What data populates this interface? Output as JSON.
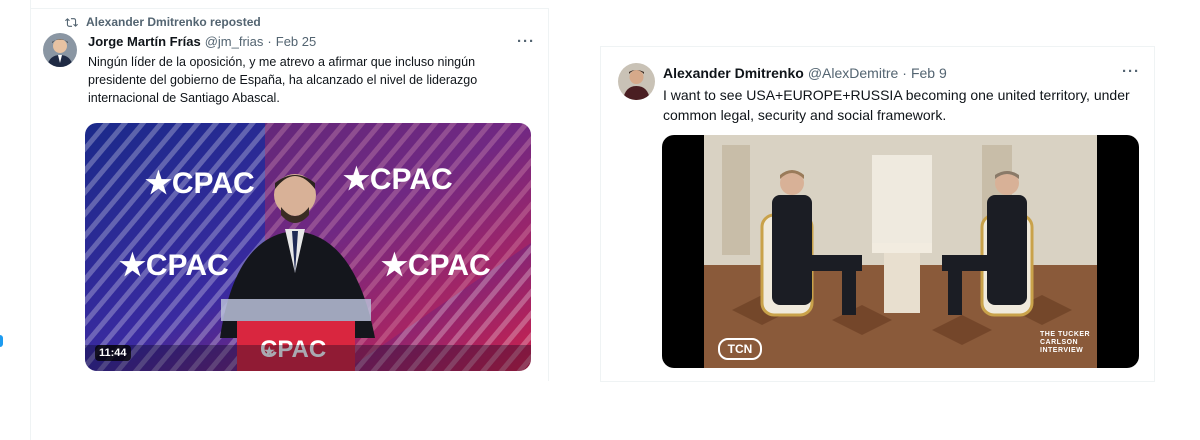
{
  "tweet1": {
    "repost_label": "Alexander Dmitrenko reposted",
    "author_name": "Jorge Martín Frías",
    "handle": "@jm_frias",
    "dot": "·",
    "date": "Feb 25",
    "more": "···",
    "text": "Ningún líder de la oposición, y me atrevo a afirmar que incluso ningún presidente del gobierno de España, ha alcanzado el nivel de liderazgo internacional de Santiago Abascal.",
    "video_duration": "11:44",
    "media_logo": "CPAC"
  },
  "tweet2": {
    "author_name": "Alexander Dmitrenko",
    "handle": "@AlexDemitre",
    "dot": "·",
    "date": "Feb 9",
    "more": "···",
    "text": "I want to see USA+EUROPE+RUSSIA becoming one united territory, under common legal, security and social framework.",
    "media_logo": "TCN",
    "media_credit": "THE TUCKER CARLSON INTERVIEW"
  },
  "icons": [
    "repost-icon",
    "more-icon"
  ],
  "colors": {
    "accent": "#1d9bf0",
    "muted": "#536471",
    "text": "#0f1419"
  }
}
